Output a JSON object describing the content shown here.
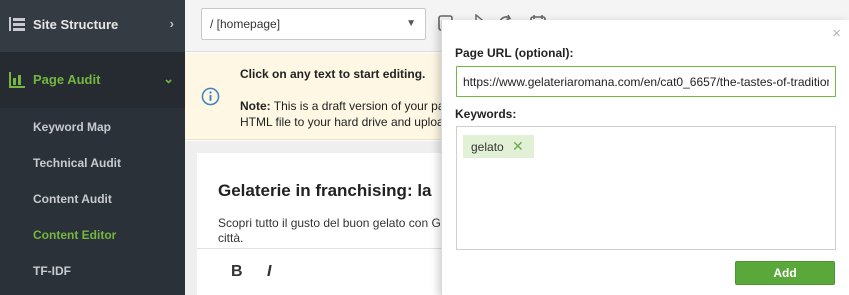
{
  "sidebar": {
    "site_structure": {
      "label": "Site Structure",
      "icon": "list-tree-icon",
      "chevron": "›"
    },
    "page_audit": {
      "label": "Page Audit",
      "icon": "bar-chart-icon",
      "chevron": "⌄"
    },
    "items": [
      {
        "label": "Keyword Map"
      },
      {
        "label": "Technical Audit"
      },
      {
        "label": "Content Audit"
      },
      {
        "label": "Content Editor"
      },
      {
        "label": "TF-IDF"
      }
    ],
    "active_color": "#73b740"
  },
  "toolbar": {
    "page_select_value": "/ [homepage]",
    "icons": [
      "copy-icon",
      "cursor-icon",
      "refresh-icon",
      "calendar-icon"
    ]
  },
  "notice": {
    "title": "Click on any text to start editing.",
    "note_label": "Note:",
    "note_text": " This is a draft version of your pa",
    "note_text_line2": "HTML file to your hard drive and uploa"
  },
  "editor": {
    "title": "Gelaterie in franchising: la",
    "intro_line1": "Scopri tutto il gusto del buon gelato con G",
    "intro_line2": "città.",
    "bold_label": "B",
    "italic_label": "I"
  },
  "popup": {
    "close": "×",
    "url_label": "Page URL (optional):",
    "url_value": "https://www.gelateriaromana.com/en/cat0_6657/the-tastes-of-tradition",
    "keywords_label": "Keywords:",
    "keywords": [
      "gelato"
    ],
    "tag_remove": "✕",
    "add_label": "Add",
    "accent": "#5aa83a"
  }
}
